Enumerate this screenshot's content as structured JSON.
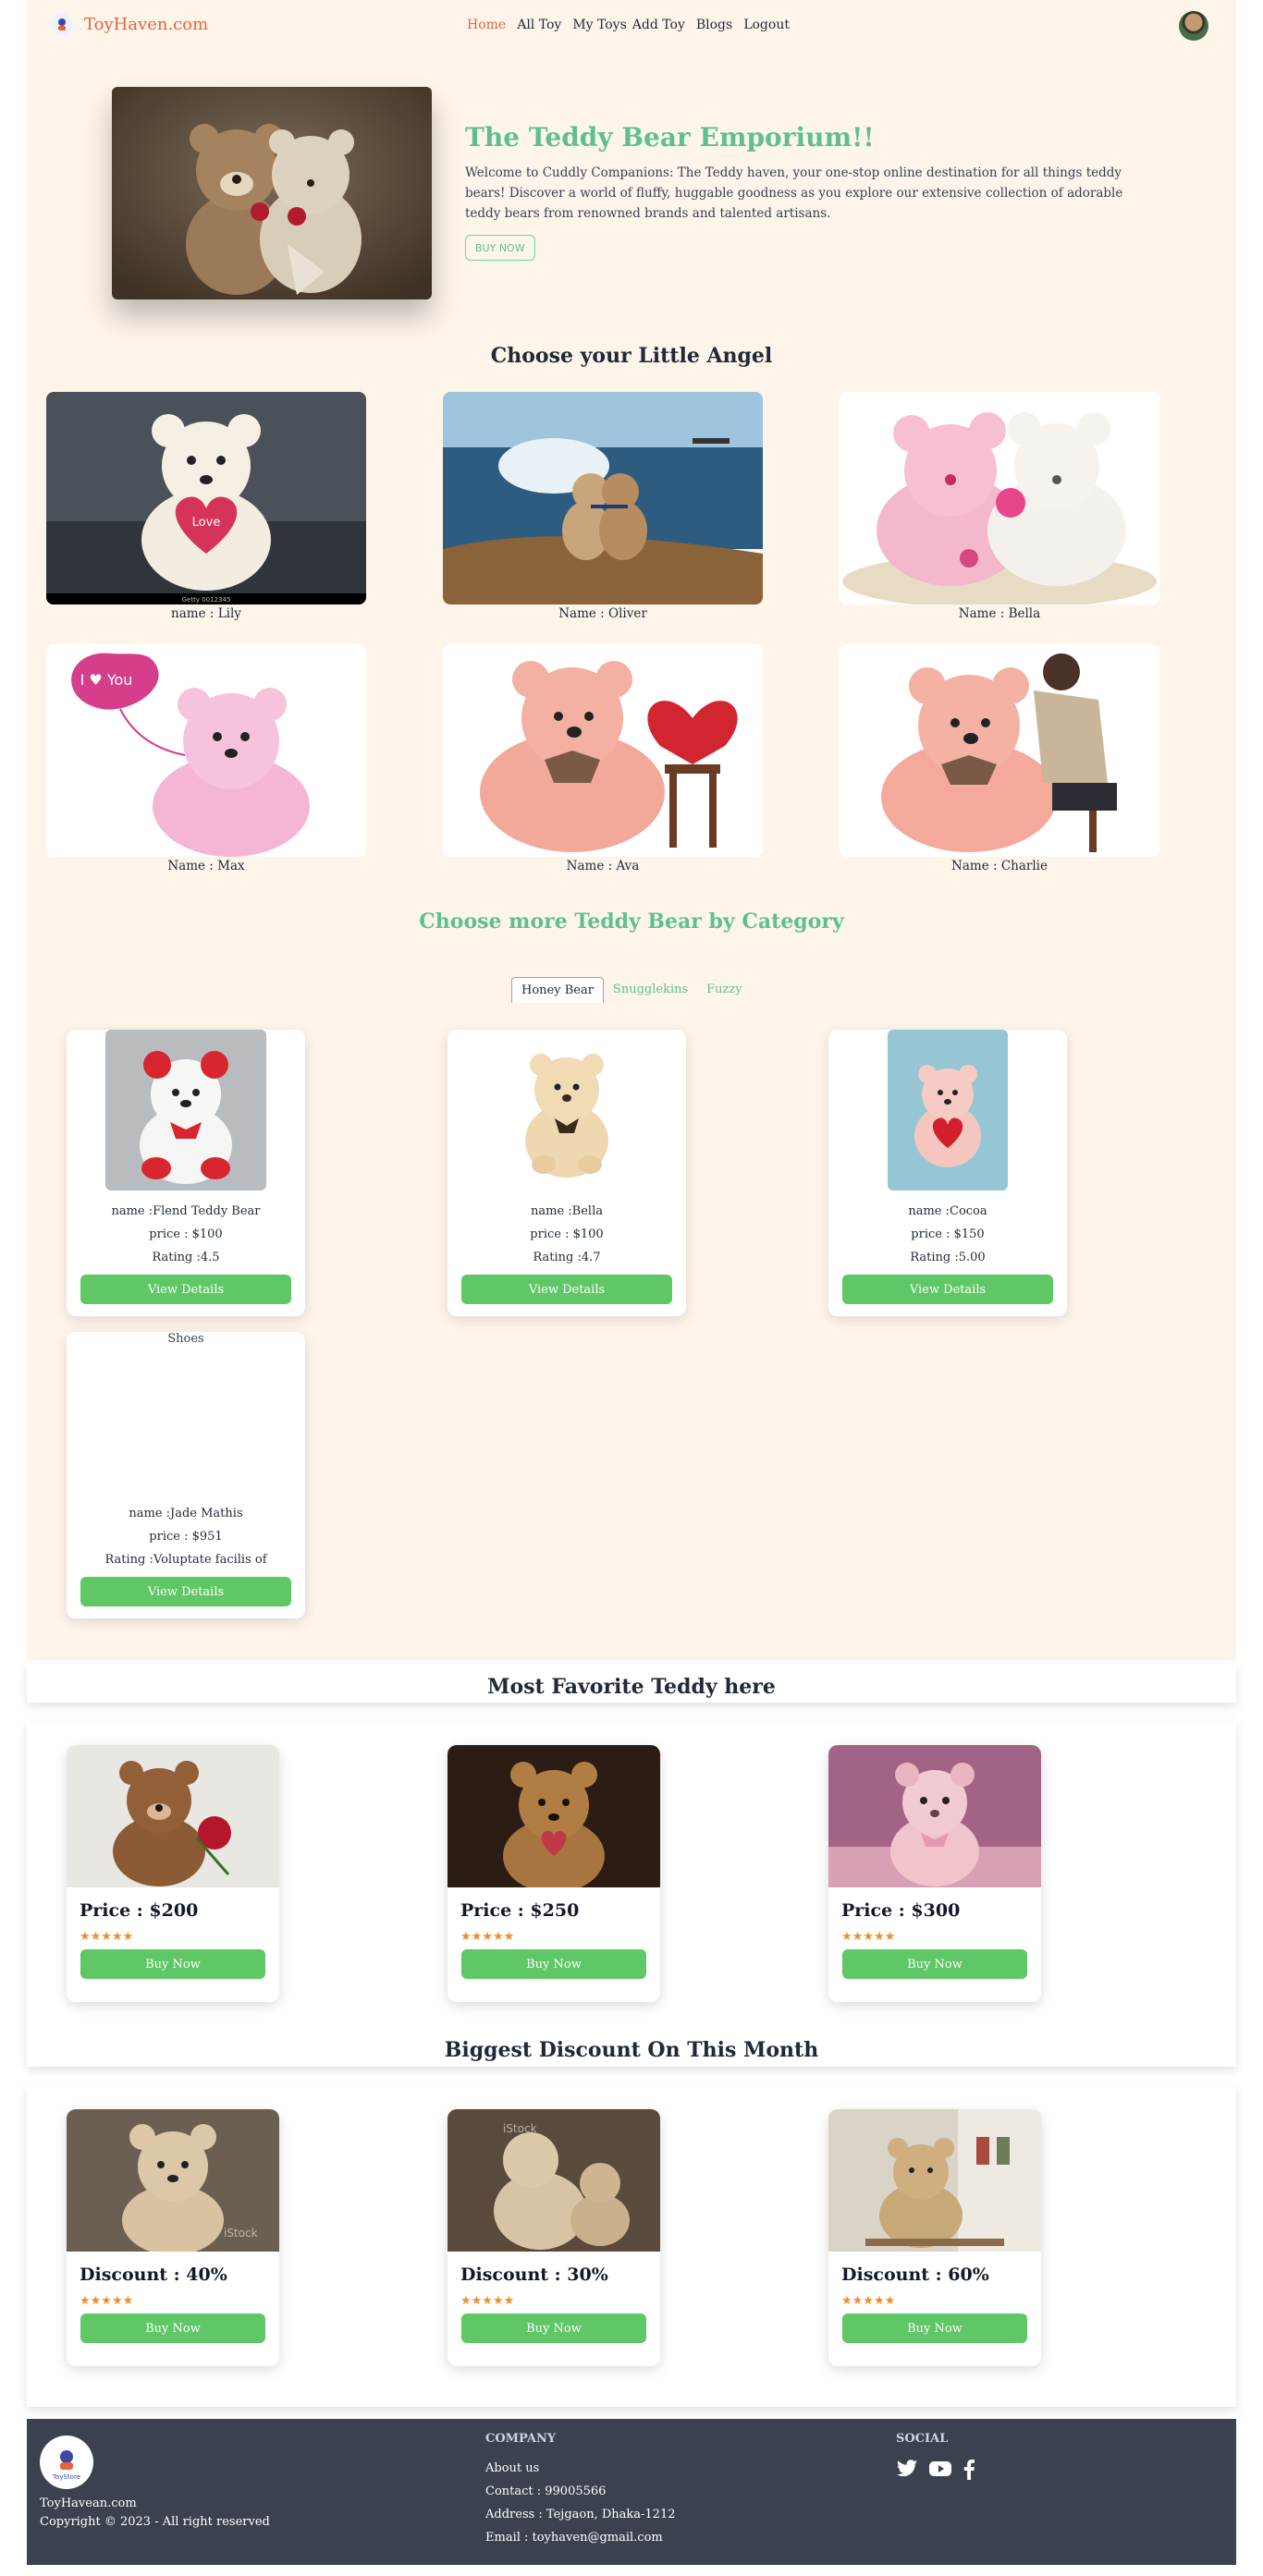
{
  "nav": {
    "brand": "ToyHaven.com",
    "links": [
      "Home",
      "All Toy",
      "My Toys",
      "Add Toy",
      "Blogs",
      "Logout"
    ],
    "accent": "#e8633a"
  },
  "hero": {
    "title": "The Teddy Bear Emporium!!",
    "description": "Welcome to Cuddly Companions: The Teddy haven, your one-stop online destination for all things teddy bears! Discover a world of fluffy, huggable goodness as you explore our extensive collection of adorable teddy bears from renowned brands and talented artisans.",
    "button": "BUY NOW"
  },
  "gallery": {
    "title": "Choose your Little Angel",
    "items": [
      {
        "caption": "name : Lily"
      },
      {
        "caption": "Name : Oliver"
      },
      {
        "caption": "Name : Bella"
      },
      {
        "caption": "Name : Max"
      },
      {
        "caption": "Name : Ava"
      },
      {
        "caption": "Name : Charlie"
      }
    ],
    "love_text": "Love",
    "i_you_text": "I ♥ You",
    "watermark": "Getty 0012345"
  },
  "category": {
    "title": "Choose more Teddy Bear by Category",
    "tabs": [
      "Honey Bear",
      "Snugglekins",
      "Fuzzy"
    ],
    "cards": [
      {
        "name": "name :Flend Teddy Bear",
        "price": "price : $100",
        "rating": "Rating :4.5",
        "button": "View Details"
      },
      {
        "name": "name :Bella",
        "price": "price : $100",
        "rating": "Rating :4.7",
        "button": "View Details"
      },
      {
        "name": "name :Cocoa",
        "price": "price : $150",
        "rating": "Rating :5.00",
        "button": "View Details"
      },
      {
        "name": "name :Jade Mathis",
        "price": "price : $951",
        "rating": "Rating :Voluptate facilis of",
        "button": "View Details",
        "alt": "Shoes"
      }
    ]
  },
  "favorite": {
    "title": "Most Favorite Teddy here",
    "cards": [
      {
        "price": "Price : $200",
        "button": "Buy Now",
        "stars": "★★★★★"
      },
      {
        "price": "Price : $250",
        "button": "Buy Now",
        "stars": "★★★★★"
      },
      {
        "price": "Price : $300",
        "button": "Buy Now",
        "stars": "★★★★★"
      }
    ]
  },
  "discount": {
    "title": "Biggest Discount On This Month",
    "cards": [
      {
        "price": "Discount : 40%",
        "button": "Buy Now",
        "stars": "★★★★★"
      },
      {
        "price": "Discount : 30%",
        "button": "Buy Now",
        "stars": "★★★★★"
      },
      {
        "price": "Discount : 60%",
        "button": "Buy Now",
        "stars": "★★★★★"
      }
    ],
    "watermark": "iStock"
  },
  "footer": {
    "logo_text": "ToyStore",
    "name": "ToyHavean.com",
    "copyright": "Copyright © 2023 - All right reserved",
    "company_heading": "COMPANY",
    "company_links": [
      "About us",
      "Contact : 99005566",
      "Address : Tejgaon, Dhaka-1212",
      "Email : toyhaven@gmail.com"
    ],
    "social_heading": "SOCIAL",
    "social_icons": [
      "twitter-icon",
      "youtube-icon",
      "facebook-icon"
    ]
  }
}
